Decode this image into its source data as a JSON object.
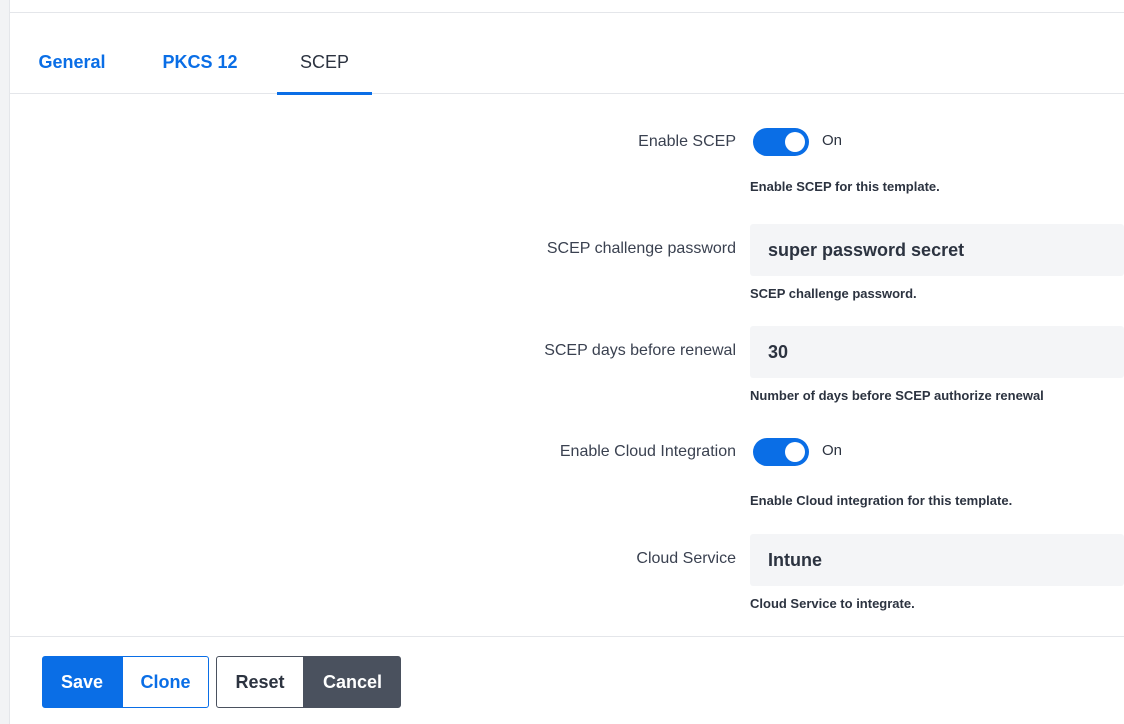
{
  "tabs": [
    {
      "label": "General"
    },
    {
      "label": "PKCS 12"
    },
    {
      "label": "SCEP"
    }
  ],
  "active_tab": "SCEP",
  "form": {
    "enable_scep": {
      "label": "Enable SCEP",
      "state": "On",
      "help": "Enable SCEP for this template."
    },
    "challenge_password": {
      "label": "SCEP challenge password",
      "value": "super password secret",
      "help": "SCEP challenge password."
    },
    "days_before_renewal": {
      "label": "SCEP days before renewal",
      "value": "30",
      "help": "Number of days before SCEP authorize renewal"
    },
    "enable_cloud": {
      "label": "Enable Cloud Integration",
      "state": "On",
      "help": "Enable Cloud integration for this template."
    },
    "cloud_service": {
      "label": "Cloud Service",
      "value": "Intune",
      "help": "Cloud Service to integrate."
    }
  },
  "buttons": {
    "save": "Save",
    "clone": "Clone",
    "reset": "Reset",
    "cancel": "Cancel"
  },
  "colors": {
    "accent": "#0a6ee6",
    "dark_button": "#4a515e",
    "input_bg": "#f4f5f7"
  }
}
